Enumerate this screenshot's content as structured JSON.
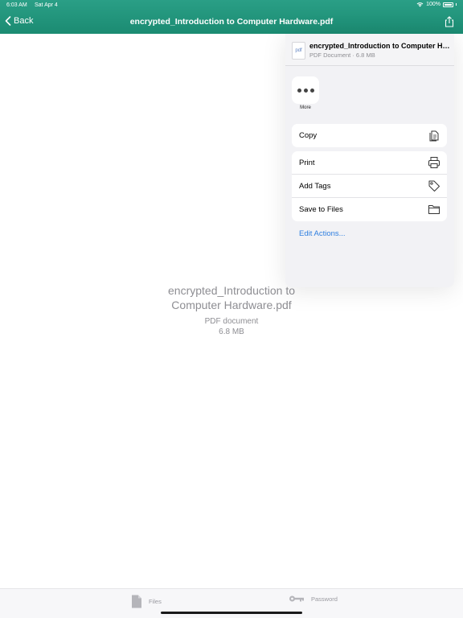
{
  "status_bar": {
    "time": "6:03 AM",
    "date": "Sat Apr 4",
    "battery": "100%"
  },
  "nav": {
    "back_label": "Back",
    "title": "encrypted_Introduction to Computer Hardware.pdf"
  },
  "document": {
    "name": "encrypted_Introduction to Computer Hardware.pdf",
    "type": "PDF document",
    "size": "6.8 MB"
  },
  "share_sheet": {
    "file_icon_label": "pdf",
    "file_title": "encrypted_Introduction to Computer Hardware.pdf",
    "file_subtitle": "PDF Document · 6.8 MB",
    "more_label": "More",
    "copy_label": "Copy",
    "actions": [
      {
        "label": "Print",
        "icon": "printer-icon"
      },
      {
        "label": "Add Tags",
        "icon": "tag-icon"
      },
      {
        "label": "Save to Files",
        "icon": "folder-icon"
      }
    ],
    "edit_actions_label": "Edit Actions...",
    "accent_color": "#2f7fe0"
  },
  "tab_bar": {
    "files_label": "Files",
    "password_label": "Password"
  },
  "colors": {
    "header": "#1f917a",
    "background": "#ffffff"
  }
}
